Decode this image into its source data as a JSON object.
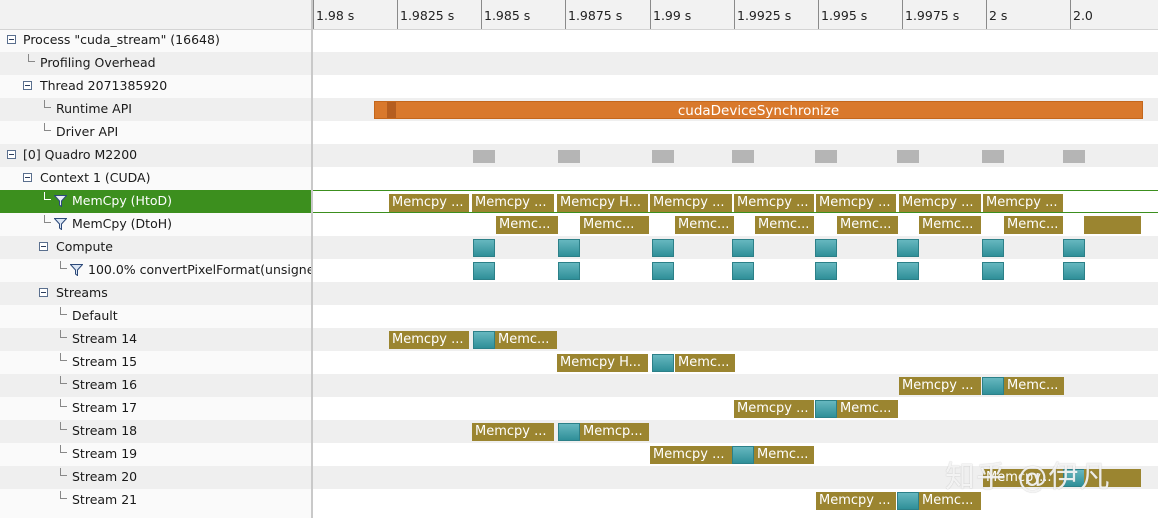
{
  "ruler": {
    "ticks": [
      "1.98 s",
      "1.9825 s",
      "1.985 s",
      "1.9875 s",
      "1.99 s",
      "1.9925 s",
      "1.995 s",
      "1.9975 s",
      "2 s",
      "2.0"
    ]
  },
  "tree": {
    "process": "Process \"cuda_stream\" (16648)",
    "profiling_overhead": "Profiling Overhead",
    "thread": "Thread 2071385920",
    "runtime_api": "Runtime API",
    "driver_api": "Driver API",
    "device": "[0] Quadro M2200",
    "context": "Context 1 (CUDA)",
    "memcpy_htod": "MemCpy (HtoD)",
    "memcpy_dtoh": "MemCpy (DtoH)",
    "compute": "Compute",
    "kernel": "100.0% convertPixelFormat(unsigne...",
    "streams": "Streams",
    "default": "Default",
    "stream_14": "Stream 14",
    "stream_15": "Stream 15",
    "stream_16": "Stream 16",
    "stream_17": "Stream 17",
    "stream_18": "Stream 18",
    "stream_19": "Stream 19",
    "stream_20": "Stream 20",
    "stream_21": "Stream 21"
  },
  "timeline": {
    "runtime_call": "cudaDeviceSynchronize",
    "htod_labels": [
      "Memcpy ...",
      "Memcpy ...",
      "Memcpy H...",
      "Memcpy ...",
      "Memcpy ...",
      "Memcpy ...",
      "Memcpy ...",
      "Memcpy ..."
    ],
    "dtoh_labels": [
      "Memc...",
      "Memc...",
      "Memc...",
      "Memc...",
      "Memc...",
      "Memc...",
      "Memc...",
      ""
    ],
    "stream_14": [
      "Memcpy ...",
      "Memc..."
    ],
    "stream_15": [
      "Memcpy H...",
      "Memc..."
    ],
    "stream_16": [
      "Memcpy ...",
      "Memc..."
    ],
    "stream_17": [
      "Memcpy ...",
      "Memc..."
    ],
    "stream_18": [
      "Memcpy ...",
      "Memcp..."
    ],
    "stream_19": [
      "Memcpy ...",
      "Memc..."
    ],
    "stream_20": [
      "Memcpy..."
    ],
    "stream_21": [
      "Memcpy ...",
      "Memc..."
    ]
  },
  "watermark": "知乎 @伊凡",
  "colors": {
    "selected_row": "#3c8f1e",
    "memcpy": "#9b8530",
    "kernel": "#2f8f98",
    "runtime": "#d9792c",
    "overhead": "#b5b5b5"
  }
}
